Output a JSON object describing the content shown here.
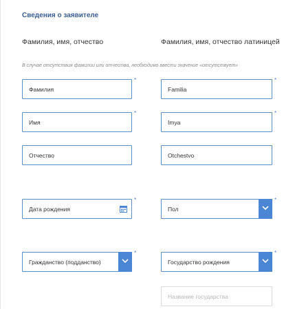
{
  "section_title": "Сведения о заявителе",
  "left_column": {
    "heading": "Фамилия, имя, отчество"
  },
  "right_column": {
    "heading": "Фамилия, имя, отчество латиницей"
  },
  "hint": "В случае отсутствия фамилии или отчества, необходимо ввести значение «отсутствует»",
  "required_mark": "*",
  "fields": {
    "surname": "Фамилия",
    "name": "Имя",
    "patronymic": "Отчество",
    "surname_latin": "Familia",
    "name_latin": "Imya",
    "patronymic_latin": "Otchestvo",
    "birth_date": "Дата рождения",
    "gender": "Пол",
    "citizenship": "Гражданство (подданство)",
    "birth_country": "Государство рождения",
    "country_name_placeholder": "Название государства"
  },
  "icons": {
    "calendar": "calendar-icon",
    "dropdown": "chevron-down-icon"
  },
  "colors": {
    "accent": "#4a86d4",
    "title": "#3a5f95",
    "border": "#5b8dc9"
  }
}
